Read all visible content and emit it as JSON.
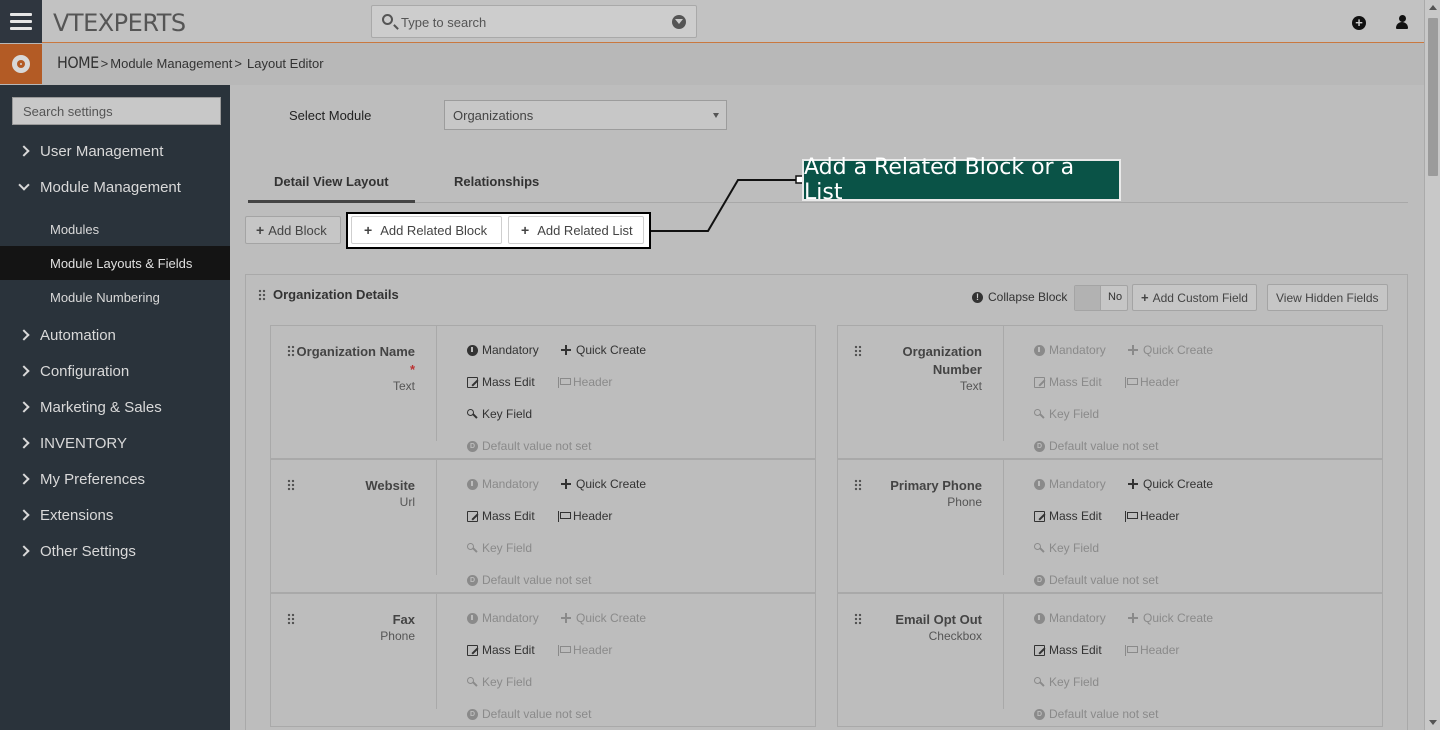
{
  "app": {
    "logo": "VTEXPERTS"
  },
  "search": {
    "placeholder": "Type to search"
  },
  "breadcrumb": {
    "home": "HOME",
    "sep1": ">",
    "module": "Module Management",
    "sep2": ">",
    "page": "Layout Editor"
  },
  "sidebar": {
    "search_placeholder": "Search settings",
    "items": [
      {
        "label": "User Management"
      },
      {
        "label": "Module Management"
      },
      {
        "label": "Automation"
      },
      {
        "label": "Configuration"
      },
      {
        "label": "Marketing & Sales"
      },
      {
        "label": "INVENTORY"
      },
      {
        "label": "My Preferences"
      },
      {
        "label": "Extensions"
      },
      {
        "label": "Other Settings"
      }
    ],
    "subitems": [
      {
        "label": "Modules"
      },
      {
        "label": "Module Layouts & Fields"
      },
      {
        "label": "Module Numbering"
      }
    ]
  },
  "main": {
    "select_label": "Select Module",
    "select_value": "Organizations",
    "tabs": [
      {
        "label": "Detail View Layout"
      },
      {
        "label": "Relationships"
      }
    ],
    "add_block": "Add Block",
    "add_related_block": "Add Related Block",
    "add_related_list": "Add Related List",
    "callout": "Add a Related Block or a List",
    "block": {
      "title": "Organization Details",
      "collapse_label": "Collapse Block",
      "collapse_value": "No",
      "add_custom_field": "Add Custom Field",
      "view_hidden_fields": "View Hidden Fields"
    },
    "props": {
      "mandatory": "Mandatory",
      "quick_create": "Quick Create",
      "mass_edit": "Mass Edit",
      "header": "Header",
      "key_field": "Key Field",
      "default": "Default value not set",
      "default_icon": "D"
    },
    "fields": [
      {
        "name": "Organization Name",
        "req": "*",
        "type": "Text"
      },
      {
        "name": "Organization Number",
        "req": "",
        "type": "Text"
      },
      {
        "name": "Website",
        "req": "",
        "type": "Url"
      },
      {
        "name": "Primary Phone",
        "req": "",
        "type": "Phone"
      },
      {
        "name": "Fax",
        "req": "",
        "type": "Phone"
      },
      {
        "name": "Email Opt Out",
        "req": "",
        "type": "Checkbox"
      }
    ]
  },
  "colors": {
    "accent": "#b35b25",
    "callout_bg": "#0a5347",
    "sidebar_bg": "#2a333b"
  }
}
